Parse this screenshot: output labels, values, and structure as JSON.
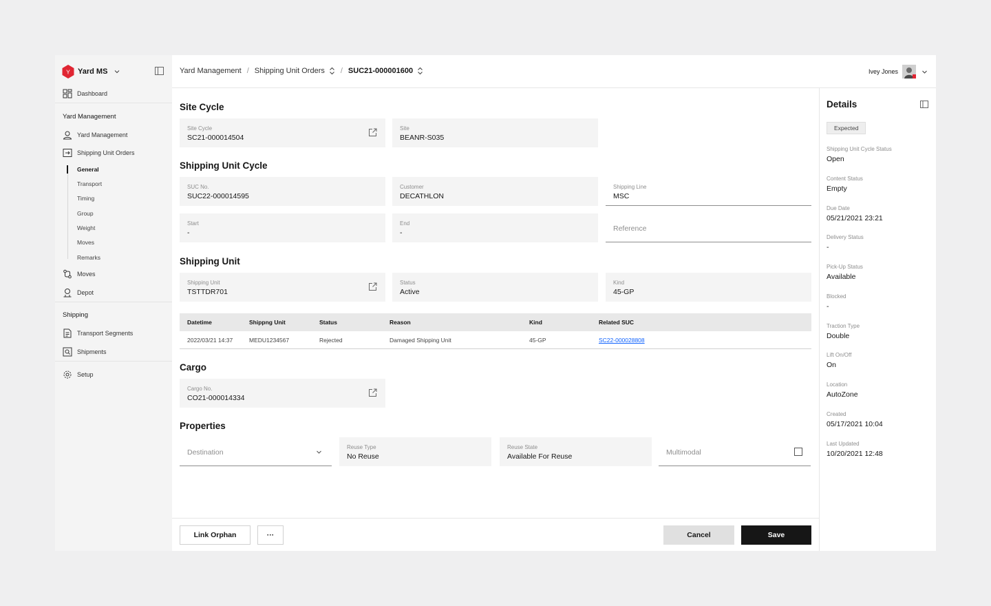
{
  "app": {
    "brand": "Yard MS"
  },
  "sidebar": {
    "dashboard": "Dashboard",
    "section_yard": "Yard Management",
    "yard_management": "Yard Management",
    "shipping_unit_orders": "Shipping Unit Orders",
    "sub_items": [
      "General",
      "Transport",
      "Timing",
      "Group",
      "Weight",
      "Moves",
      "Remarks"
    ],
    "moves": "Moves",
    "depot": "Depot",
    "section_shipping": "Shipping",
    "transport_segments": "Transport Segments",
    "shipments": "Shipments",
    "setup": "Setup"
  },
  "header": {
    "breadcrumbs": [
      "Yard Management",
      "Shipping Unit Orders",
      "SUC21-000001600"
    ],
    "user_name": "Ivey Jones"
  },
  "site_cycle": {
    "title": "Site Cycle",
    "site_cycle_label": "Site Cycle",
    "site_cycle_value": "SC21-000014504",
    "site_label": "Site",
    "site_value": "BEANR-S035"
  },
  "shipping_unit_cycle": {
    "title": "Shipping Unit Cycle",
    "suc_label": "SUC No.",
    "suc_value": "SUC22-000014595",
    "customer_label": "Customer",
    "customer_value": "DECATHLON",
    "line_label": "Shipping Line",
    "line_value": "MSC",
    "start_label": "Start",
    "start_value": "-",
    "end_label": "End",
    "end_value": "-",
    "reference_placeholder": "Reference"
  },
  "shipping_unit": {
    "title": "Shipping Unit",
    "unit_label": "Shipping Unit",
    "unit_value": "TSTTDR701",
    "status_label": "Status",
    "status_value": "Active",
    "kind_label": "Kind",
    "kind_value": "45-GP",
    "table": {
      "headers": [
        "Datetime",
        "Shippng Unit",
        "Status",
        "Reason",
        "Kind",
        "Related SUC"
      ],
      "rows": [
        [
          "2022/03/21 14:37",
          "MEDU1234567",
          "Rejected",
          "Damaged Shipping Unit",
          "45-GP",
          "SC22-000028808"
        ]
      ]
    }
  },
  "cargo": {
    "title": "Cargo",
    "cargo_label": "Cargo No.",
    "cargo_value": "CO21-000014334"
  },
  "properties": {
    "title": "Properties",
    "destination_placeholder": "Destination",
    "reuse_type_label": "Reuse Type",
    "reuse_type_value": "No Reuse",
    "reuse_state_label": "Reuse State",
    "reuse_state_value": "Available For Reuse",
    "multimodal_label": "Multimodal"
  },
  "footer": {
    "link_orphan": "Link Orphan",
    "more": "···",
    "cancel": "Cancel",
    "save": "Save"
  },
  "details": {
    "title": "Details",
    "badge": "Expected",
    "items": [
      {
        "label": "Shipping Unit Cycle Status",
        "value": "Open"
      },
      {
        "label": "Content Status",
        "value": "Empty"
      },
      {
        "label": "Due Date",
        "value": "05/21/2021 23:21"
      },
      {
        "label": "Delivery Status",
        "value": "-"
      },
      {
        "label": "Pick-Up Status",
        "value": "Available"
      },
      {
        "label": "Blocked",
        "value": "-"
      },
      {
        "label": "Traction Type",
        "value": "Double"
      },
      {
        "label": "Lift On/Off",
        "value": "On"
      },
      {
        "label": "Location",
        "value": "AutoZone"
      },
      {
        "label": "Created",
        "value": "05/17/2021 10:04"
      },
      {
        "label": "Last Updated",
        "value": "10/20/2021 12:48"
      }
    ]
  },
  "colors": {
    "brand": "#e02633",
    "link": "#0f62fe",
    "primary_button": "#161616"
  }
}
